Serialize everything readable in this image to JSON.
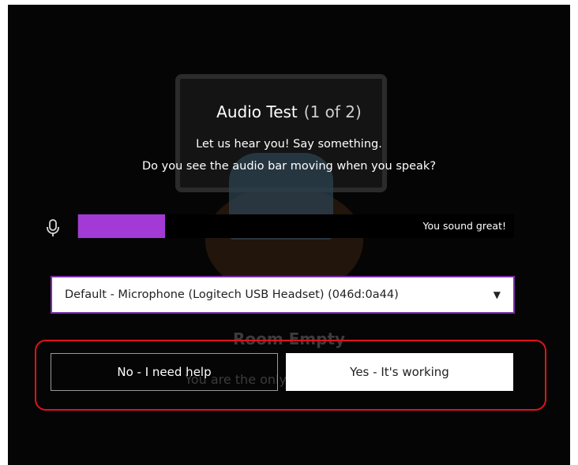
{
  "dialog": {
    "title": "Audio Test",
    "step": "(1 of 2)",
    "prompt_line1": "Let us hear you! Say something.",
    "prompt_line2": "Do you see the audio bar moving when you speak?"
  },
  "meter": {
    "icon": "microphone-icon",
    "level": 0.2,
    "status": "You sound great!",
    "fill_color": "#a33ad6"
  },
  "device_select": {
    "selected": "Default - Microphone (Logitech USB Headset) (046d:0a44)",
    "arrow": "▼"
  },
  "actions": {
    "no_label": "No - I need help",
    "yes_label": "Yes - It's working"
  },
  "background": {
    "heading": "Room Empty",
    "subtext": "You are the only o"
  },
  "colors": {
    "accent": "#7a2ea6",
    "highlight": "#e0121c"
  }
}
